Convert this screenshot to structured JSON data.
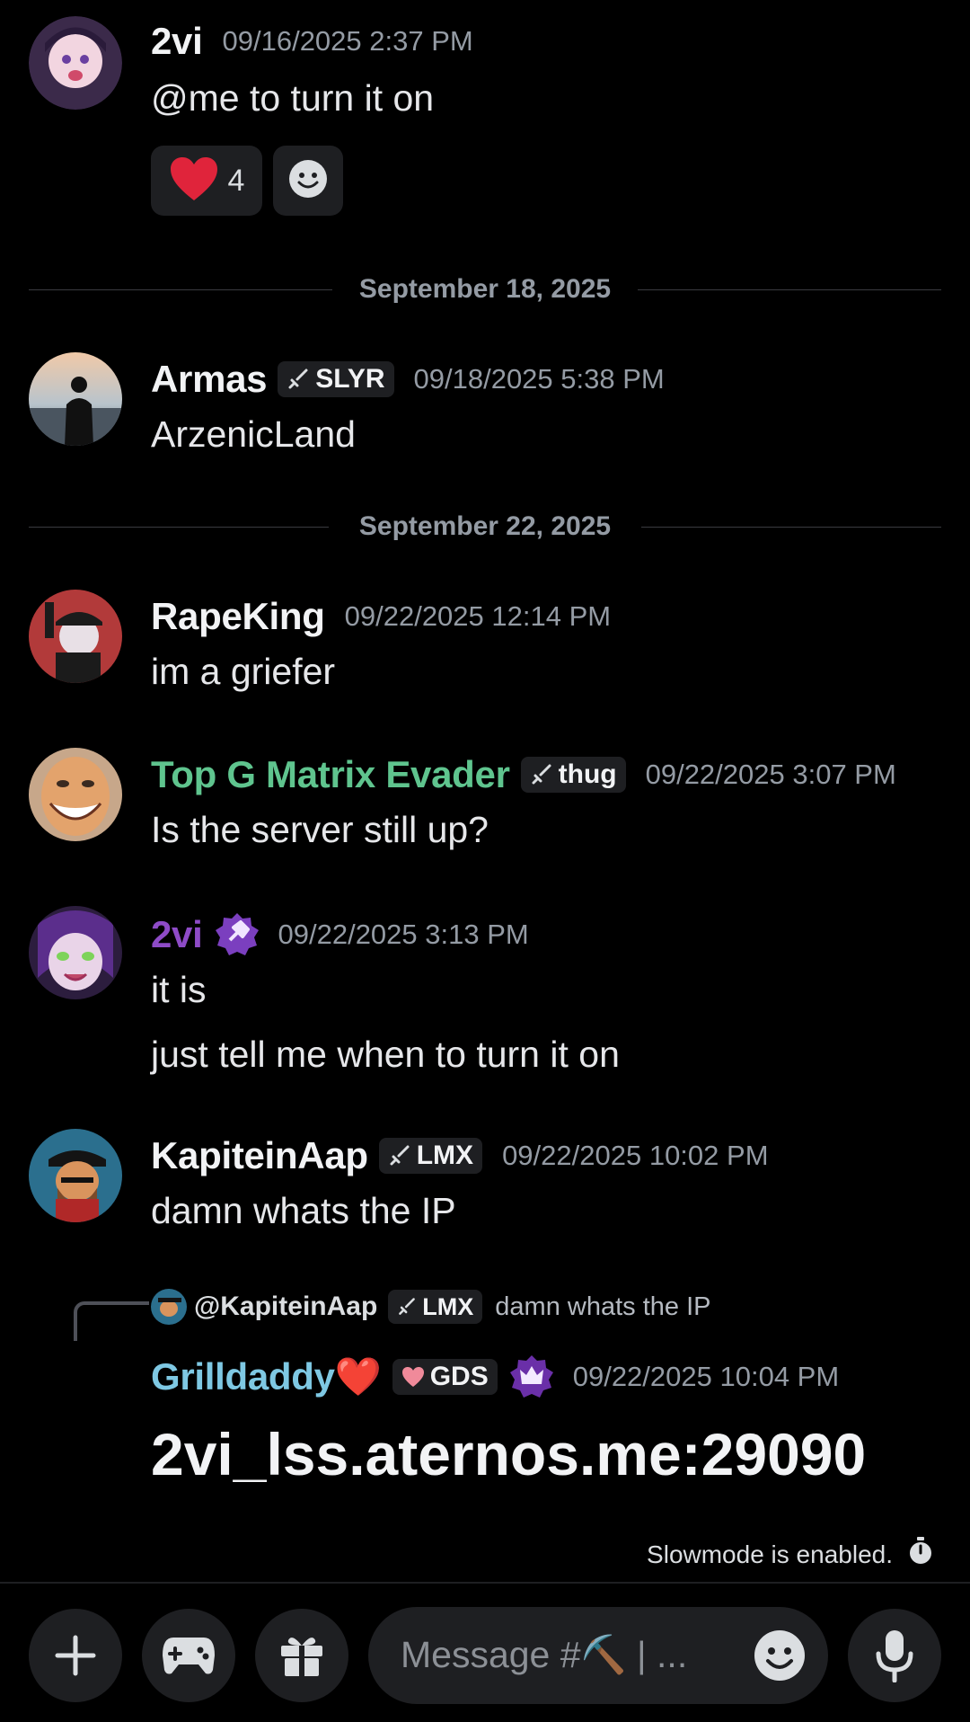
{
  "messages": {
    "m1": {
      "author": "2vi",
      "timestamp": "09/16/2025 2:37 PM",
      "text": "@me to turn it on",
      "reactions": [
        {
          "emoji": "heart",
          "count": "4"
        },
        {
          "emoji": "add-reaction-icon",
          "count": ""
        }
      ]
    },
    "d1": {
      "label": "September 18, 2025"
    },
    "m2": {
      "author": "Armas",
      "tag": "SLYR",
      "timestamp": "09/18/2025 5:38 PM",
      "text": "ArzenicLand"
    },
    "d2": {
      "label": "September 22, 2025"
    },
    "m3": {
      "author": "RapeKing",
      "timestamp": "09/22/2025 12:14 PM",
      "text": "im a griefer"
    },
    "m4": {
      "author": "Top G Matrix Evader",
      "author_color": "#5fc48e",
      "tag": "thug",
      "timestamp": "09/22/2025 3:07 PM",
      "text": "Is the server still up?"
    },
    "m5": {
      "author": "2vi",
      "author_color": "#8e4bc7",
      "badge": "moderator-hammer-badge",
      "timestamp": "09/22/2025 3:13 PM",
      "text": "it is",
      "text2": "just tell me when to turn it on"
    },
    "m6": {
      "author": "KapiteinAap",
      "tag": "LMX",
      "timestamp": "09/22/2025 10:02 PM",
      "text": "damn whats the IP"
    },
    "m7": {
      "reply": {
        "author": "@KapiteinAap",
        "tag": "LMX",
        "text": "damn whats the IP"
      },
      "author": "Grilldaddy❤️",
      "author_color": "#7ec8e3",
      "tag": "GDS",
      "badge": "crown-badge",
      "timestamp": "09/22/2025 10:04 PM",
      "text": "2vi_lss.aternos.me:29090"
    }
  },
  "slowmode": {
    "text": "Slowmode is enabled."
  },
  "composer": {
    "placeholder": "Message #⛏️ | ..."
  },
  "colors": {
    "background": "#000000",
    "surface": "#1e1f22",
    "muted": "#949ba4"
  }
}
